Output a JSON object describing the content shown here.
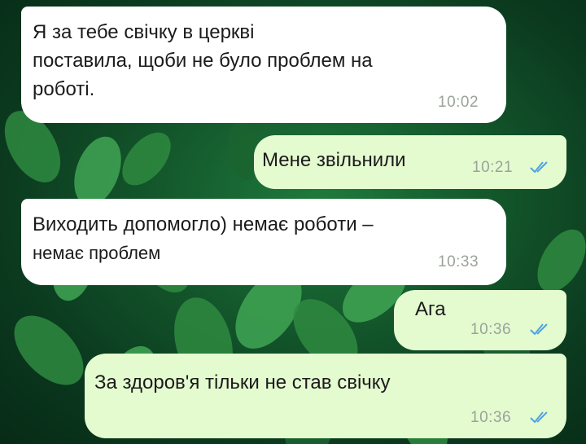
{
  "chat": {
    "accent_incoming": "#ffffff",
    "accent_outgoing": "#e4fbd0",
    "read_tick_color": "#4fa3e0",
    "messages": [
      {
        "direction": "incoming",
        "lines": [
          "Я за тебе свічку в церкві",
          "поставила, щоби не було проблем на",
          "роботі."
        ],
        "time": "10:02"
      },
      {
        "direction": "outgoing",
        "lines": [
          "Мене звільнили"
        ],
        "time": "10:21",
        "status": "read-double-tick-icon"
      },
      {
        "direction": "incoming",
        "lines": [
          "Виходить допомогло) немає роботи –",
          "немає проблем"
        ],
        "time": "10:33"
      },
      {
        "direction": "outgoing",
        "lines": [
          "Ага"
        ],
        "time": "10:36",
        "status": "read-double-tick-icon"
      },
      {
        "direction": "outgoing",
        "lines": [
          "За здоров'я тільки не став свічку"
        ],
        "time": "10:36",
        "status": "read-double-tick-icon"
      }
    ]
  }
}
